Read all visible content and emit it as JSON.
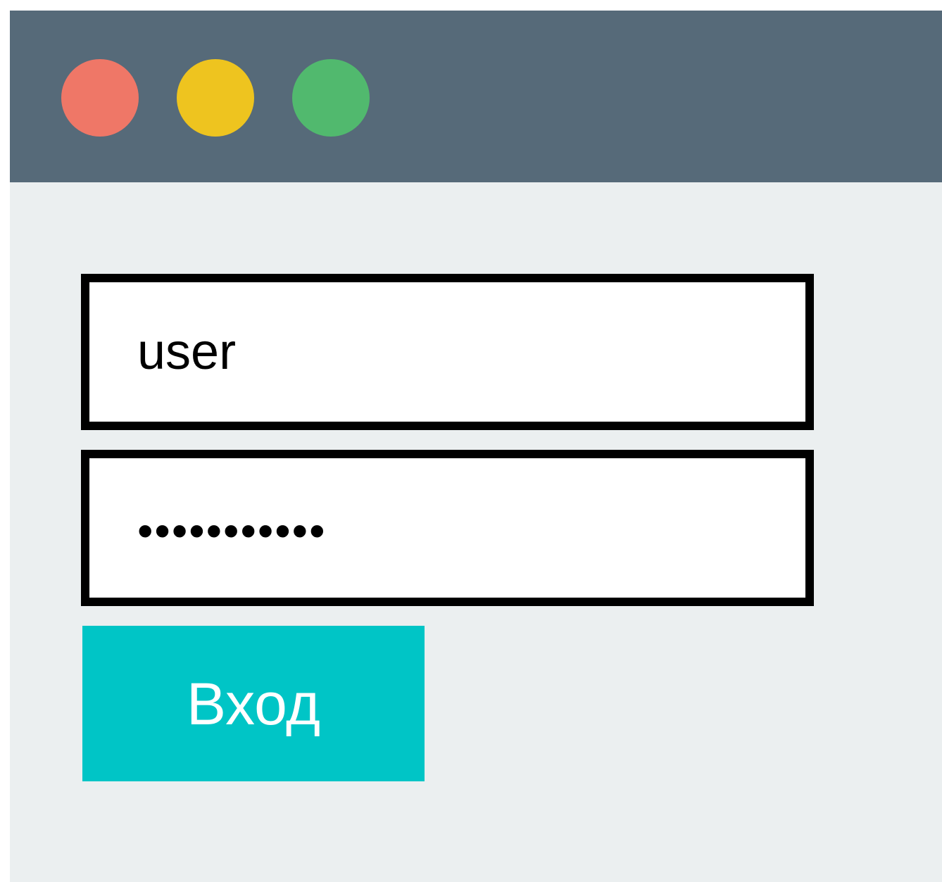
{
  "window": {
    "controls": [
      {
        "name": "close",
        "color": "#ef7767"
      },
      {
        "name": "minimize",
        "color": "#eec41f"
      },
      {
        "name": "maximize",
        "color": "#51b96e"
      }
    ]
  },
  "form": {
    "username": {
      "value": "user"
    },
    "password": {
      "value": "•••••••••••"
    },
    "submit_label": "Вход"
  },
  "colors": {
    "titlebar": "#566a79",
    "background": "#ebeff0",
    "accent": "#00c5c6"
  }
}
